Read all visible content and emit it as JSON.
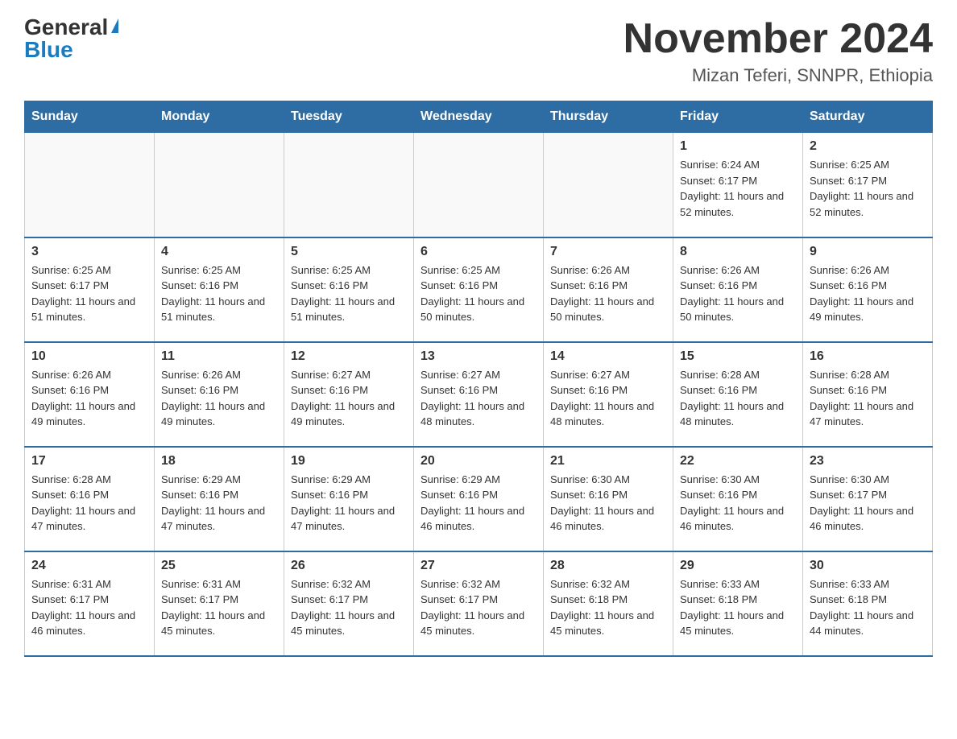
{
  "logo": {
    "general": "General",
    "blue": "Blue"
  },
  "header": {
    "month_year": "November 2024",
    "location": "Mizan Teferi, SNNPR, Ethiopia"
  },
  "days_of_week": [
    "Sunday",
    "Monday",
    "Tuesday",
    "Wednesday",
    "Thursday",
    "Friday",
    "Saturday"
  ],
  "weeks": [
    [
      {
        "day": "",
        "sunrise": "",
        "sunset": "",
        "daylight": "",
        "empty": true
      },
      {
        "day": "",
        "sunrise": "",
        "sunset": "",
        "daylight": "",
        "empty": true
      },
      {
        "day": "",
        "sunrise": "",
        "sunset": "",
        "daylight": "",
        "empty": true
      },
      {
        "day": "",
        "sunrise": "",
        "sunset": "",
        "daylight": "",
        "empty": true
      },
      {
        "day": "",
        "sunrise": "",
        "sunset": "",
        "daylight": "",
        "empty": true
      },
      {
        "day": "1",
        "sunrise": "Sunrise: 6:24 AM",
        "sunset": "Sunset: 6:17 PM",
        "daylight": "Daylight: 11 hours and 52 minutes.",
        "empty": false
      },
      {
        "day": "2",
        "sunrise": "Sunrise: 6:25 AM",
        "sunset": "Sunset: 6:17 PM",
        "daylight": "Daylight: 11 hours and 52 minutes.",
        "empty": false
      }
    ],
    [
      {
        "day": "3",
        "sunrise": "Sunrise: 6:25 AM",
        "sunset": "Sunset: 6:17 PM",
        "daylight": "Daylight: 11 hours and 51 minutes.",
        "empty": false
      },
      {
        "day": "4",
        "sunrise": "Sunrise: 6:25 AM",
        "sunset": "Sunset: 6:16 PM",
        "daylight": "Daylight: 11 hours and 51 minutes.",
        "empty": false
      },
      {
        "day": "5",
        "sunrise": "Sunrise: 6:25 AM",
        "sunset": "Sunset: 6:16 PM",
        "daylight": "Daylight: 11 hours and 51 minutes.",
        "empty": false
      },
      {
        "day": "6",
        "sunrise": "Sunrise: 6:25 AM",
        "sunset": "Sunset: 6:16 PM",
        "daylight": "Daylight: 11 hours and 50 minutes.",
        "empty": false
      },
      {
        "day": "7",
        "sunrise": "Sunrise: 6:26 AM",
        "sunset": "Sunset: 6:16 PM",
        "daylight": "Daylight: 11 hours and 50 minutes.",
        "empty": false
      },
      {
        "day": "8",
        "sunrise": "Sunrise: 6:26 AM",
        "sunset": "Sunset: 6:16 PM",
        "daylight": "Daylight: 11 hours and 50 minutes.",
        "empty": false
      },
      {
        "day": "9",
        "sunrise": "Sunrise: 6:26 AM",
        "sunset": "Sunset: 6:16 PM",
        "daylight": "Daylight: 11 hours and 49 minutes.",
        "empty": false
      }
    ],
    [
      {
        "day": "10",
        "sunrise": "Sunrise: 6:26 AM",
        "sunset": "Sunset: 6:16 PM",
        "daylight": "Daylight: 11 hours and 49 minutes.",
        "empty": false
      },
      {
        "day": "11",
        "sunrise": "Sunrise: 6:26 AM",
        "sunset": "Sunset: 6:16 PM",
        "daylight": "Daylight: 11 hours and 49 minutes.",
        "empty": false
      },
      {
        "day": "12",
        "sunrise": "Sunrise: 6:27 AM",
        "sunset": "Sunset: 6:16 PM",
        "daylight": "Daylight: 11 hours and 49 minutes.",
        "empty": false
      },
      {
        "day": "13",
        "sunrise": "Sunrise: 6:27 AM",
        "sunset": "Sunset: 6:16 PM",
        "daylight": "Daylight: 11 hours and 48 minutes.",
        "empty": false
      },
      {
        "day": "14",
        "sunrise": "Sunrise: 6:27 AM",
        "sunset": "Sunset: 6:16 PM",
        "daylight": "Daylight: 11 hours and 48 minutes.",
        "empty": false
      },
      {
        "day": "15",
        "sunrise": "Sunrise: 6:28 AM",
        "sunset": "Sunset: 6:16 PM",
        "daylight": "Daylight: 11 hours and 48 minutes.",
        "empty": false
      },
      {
        "day": "16",
        "sunrise": "Sunrise: 6:28 AM",
        "sunset": "Sunset: 6:16 PM",
        "daylight": "Daylight: 11 hours and 47 minutes.",
        "empty": false
      }
    ],
    [
      {
        "day": "17",
        "sunrise": "Sunrise: 6:28 AM",
        "sunset": "Sunset: 6:16 PM",
        "daylight": "Daylight: 11 hours and 47 minutes.",
        "empty": false
      },
      {
        "day": "18",
        "sunrise": "Sunrise: 6:29 AM",
        "sunset": "Sunset: 6:16 PM",
        "daylight": "Daylight: 11 hours and 47 minutes.",
        "empty": false
      },
      {
        "day": "19",
        "sunrise": "Sunrise: 6:29 AM",
        "sunset": "Sunset: 6:16 PM",
        "daylight": "Daylight: 11 hours and 47 minutes.",
        "empty": false
      },
      {
        "day": "20",
        "sunrise": "Sunrise: 6:29 AM",
        "sunset": "Sunset: 6:16 PM",
        "daylight": "Daylight: 11 hours and 46 minutes.",
        "empty": false
      },
      {
        "day": "21",
        "sunrise": "Sunrise: 6:30 AM",
        "sunset": "Sunset: 6:16 PM",
        "daylight": "Daylight: 11 hours and 46 minutes.",
        "empty": false
      },
      {
        "day": "22",
        "sunrise": "Sunrise: 6:30 AM",
        "sunset": "Sunset: 6:16 PM",
        "daylight": "Daylight: 11 hours and 46 minutes.",
        "empty": false
      },
      {
        "day": "23",
        "sunrise": "Sunrise: 6:30 AM",
        "sunset": "Sunset: 6:17 PM",
        "daylight": "Daylight: 11 hours and 46 minutes.",
        "empty": false
      }
    ],
    [
      {
        "day": "24",
        "sunrise": "Sunrise: 6:31 AM",
        "sunset": "Sunset: 6:17 PM",
        "daylight": "Daylight: 11 hours and 46 minutes.",
        "empty": false
      },
      {
        "day": "25",
        "sunrise": "Sunrise: 6:31 AM",
        "sunset": "Sunset: 6:17 PM",
        "daylight": "Daylight: 11 hours and 45 minutes.",
        "empty": false
      },
      {
        "day": "26",
        "sunrise": "Sunrise: 6:32 AM",
        "sunset": "Sunset: 6:17 PM",
        "daylight": "Daylight: 11 hours and 45 minutes.",
        "empty": false
      },
      {
        "day": "27",
        "sunrise": "Sunrise: 6:32 AM",
        "sunset": "Sunset: 6:17 PM",
        "daylight": "Daylight: 11 hours and 45 minutes.",
        "empty": false
      },
      {
        "day": "28",
        "sunrise": "Sunrise: 6:32 AM",
        "sunset": "Sunset: 6:18 PM",
        "daylight": "Daylight: 11 hours and 45 minutes.",
        "empty": false
      },
      {
        "day": "29",
        "sunrise": "Sunrise: 6:33 AM",
        "sunset": "Sunset: 6:18 PM",
        "daylight": "Daylight: 11 hours and 45 minutes.",
        "empty": false
      },
      {
        "day": "30",
        "sunrise": "Sunrise: 6:33 AM",
        "sunset": "Sunset: 6:18 PM",
        "daylight": "Daylight: 11 hours and 44 minutes.",
        "empty": false
      }
    ]
  ]
}
